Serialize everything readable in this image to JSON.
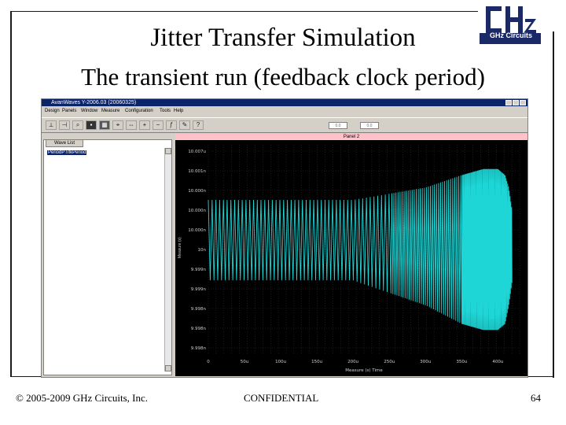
{
  "slide": {
    "title": "Jitter Transfer Simulation",
    "subtitle": "The transient run (feedback clock period)",
    "logo_text": "GHz Circuits",
    "footer_left": "© 2005-2009 GHz Circuits, Inc.",
    "footer_center": "CONFIDENTIAL",
    "footer_right": "64"
  },
  "app": {
    "window_title": "AvanWaves Y-2006.03 (20060325)",
    "menu": [
      "Design",
      "Panels",
      "Window",
      "Measure",
      "Configuration",
      "Tools",
      "Help"
    ],
    "toolbar_fields": [
      "0.0",
      "0.0"
    ],
    "panel_tab": "Wave List",
    "panel_items": [
      "PeriodPTrlkPeriod"
    ],
    "plot_header": "Panel 2",
    "y_axis_label": "Measure (s)",
    "x_axis_label": "Measure (s) Time"
  },
  "colors": {
    "waveform": "#1fd6d6",
    "plot_bg": "#000000",
    "plot_header": "#ffc2c8",
    "titlebar": "#0a246a"
  },
  "chart_data": {
    "type": "line",
    "xlabel": "Measure (s) Time",
    "ylabel": "Measure (s)",
    "x_ticks": [
      "0",
      "50u",
      "100u",
      "150u",
      "200u",
      "250u",
      "300u",
      "350u",
      "400u"
    ],
    "y_ticks": [
      "10.007u",
      "10.001n",
      "10.000n",
      "10.000n",
      "10.000n",
      "10n",
      "9.999n",
      "9.999n",
      "9.998n",
      "9.998n",
      "9.998n"
    ],
    "xlim": [
      0,
      430
    ],
    "series": [
      {
        "envelope": {
          "x": [
            0,
            50,
            100,
            150,
            200,
            250,
            300,
            350,
            380,
            400,
            410,
            415,
            420
          ],
          "upper": [
            10.0008,
            10.0008,
            10.0008,
            10.0008,
            10.0008,
            10.0009,
            10.001,
            10.0012,
            10.0013,
            10.0013,
            10.0012,
            10.001,
            10.0006
          ],
          "lower": [
            9.9995,
            9.9995,
            9.9995,
            9.9995,
            9.9995,
            9.9993,
            9.9991,
            9.9988,
            9.9987,
            9.9987,
            9.9988,
            9.9991,
            9.9995
          ]
        }
      }
    ]
  }
}
